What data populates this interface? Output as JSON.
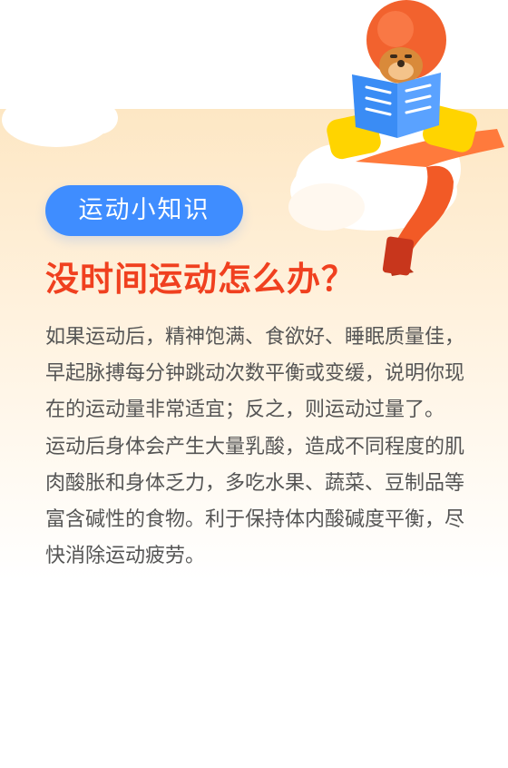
{
  "header": {
    "tag_label": "运动小知识",
    "title": "没时间运动怎么办？"
  },
  "content": {
    "paragraphs": [
      "如果运动后，精神饱满、食欲好、睡眠质量佳，早起脉搏每分钟跳动次数平衡或变缓，说明你现在的运动量非常适宜；反之，则运动过量了。",
      "运动后身体会产生大量乳酸，造成不同程度的肌肉酸胀和身体乏力，多吃水果、蔬菜、豆制品等富含碱性的食物。利于保持体内酸碱度平衡，尽快消除运动疲劳。"
    ]
  },
  "colors": {
    "tag_background": "#3f8dff",
    "title_color": "#f0401f",
    "text_color": "#555555",
    "panel_gradient_top": "#fde7c4"
  },
  "illustration": {
    "subject": "lion-mascot-reading-book-icon"
  }
}
